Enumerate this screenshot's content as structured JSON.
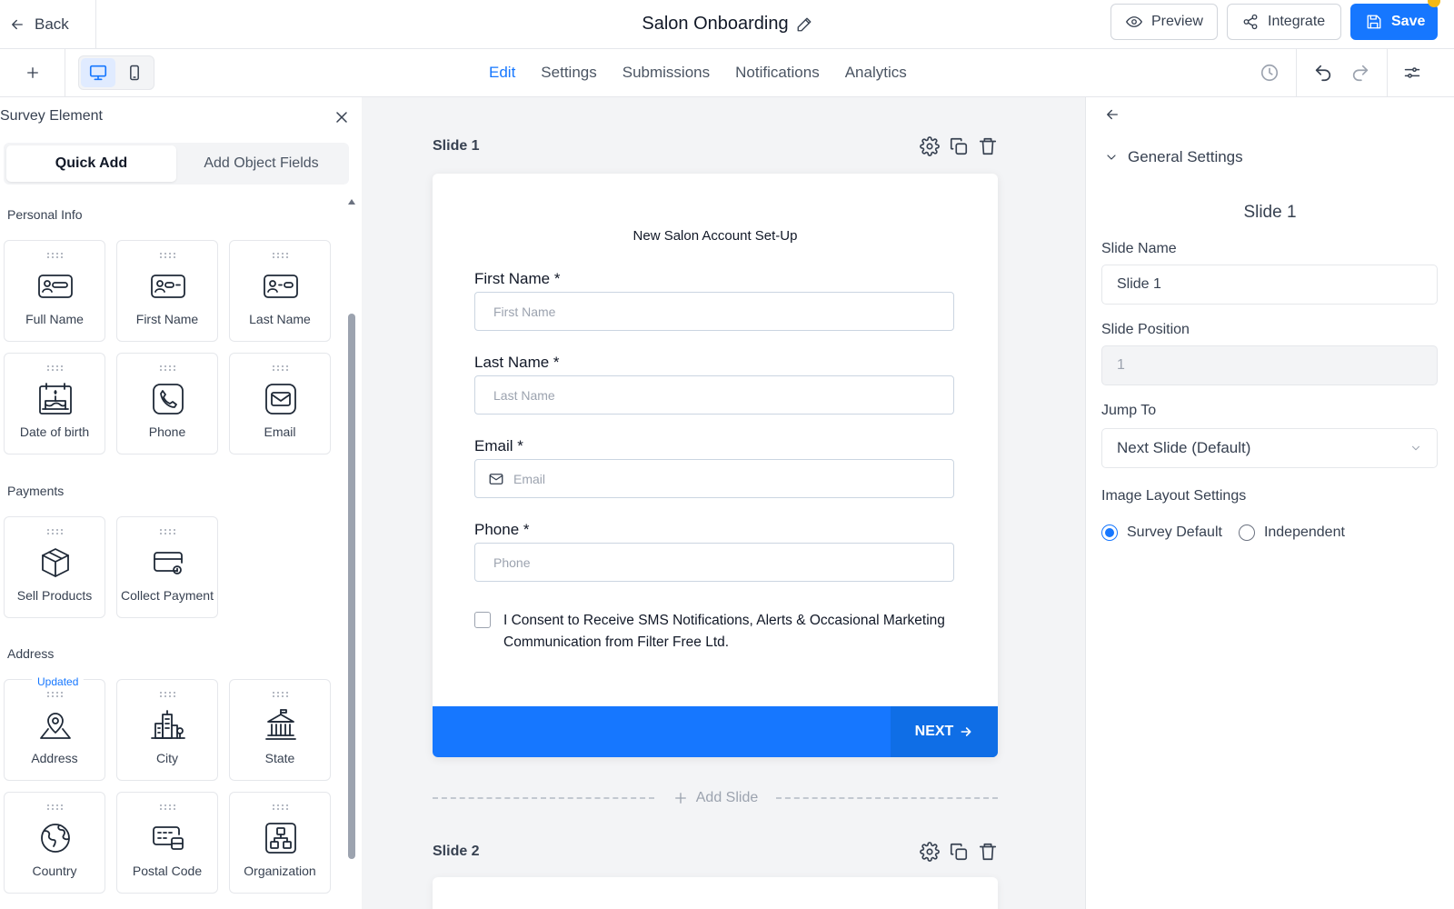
{
  "header": {
    "back_label": "Back",
    "title": "Salon Onboarding",
    "preview_label": "Preview",
    "integrate_label": "Integrate",
    "save_label": "Save"
  },
  "toolbar": {
    "tabs": [
      {
        "label": "Edit",
        "active": true
      },
      {
        "label": "Settings"
      },
      {
        "label": "Submissions"
      },
      {
        "label": "Notifications"
      },
      {
        "label": "Analytics"
      }
    ]
  },
  "left_panel": {
    "title": "Survey Element",
    "segments": [
      "Quick Add",
      "Add Object Fields"
    ],
    "sections": {
      "personal_info": {
        "label": "Personal Info",
        "items": [
          {
            "label": "Full Name",
            "icon": "id-card-icon"
          },
          {
            "label": "First Name",
            "icon": "id-card-icon"
          },
          {
            "label": "Last Name",
            "icon": "id-card-icon"
          },
          {
            "label": "Date of birth",
            "icon": "birthday-cake-icon"
          },
          {
            "label": "Phone",
            "icon": "phone-icon"
          },
          {
            "label": "Email",
            "icon": "mail-icon"
          }
        ]
      },
      "payments": {
        "label": "Payments",
        "items": [
          {
            "label": "Sell Products",
            "icon": "box-icon"
          },
          {
            "label": "Collect Payment",
            "icon": "credit-card-icon"
          }
        ]
      },
      "address": {
        "label": "Address",
        "items": [
          {
            "label": "Address",
            "icon": "map-pin-icon",
            "badge": "Updated"
          },
          {
            "label": "City",
            "icon": "city-icon"
          },
          {
            "label": "State",
            "icon": "government-building-icon"
          },
          {
            "label": "Country",
            "icon": "globe-icon"
          },
          {
            "label": "Postal Code",
            "icon": "postal-icon"
          },
          {
            "label": "Organization",
            "icon": "org-chart-icon"
          }
        ]
      }
    }
  },
  "canvas": {
    "slide1": {
      "title": "Slide 1",
      "heading": "New Salon Account Set-Up",
      "fields": [
        {
          "label": "First Name *",
          "placeholder": "First Name"
        },
        {
          "label": "Last Name *",
          "placeholder": "Last Name"
        },
        {
          "label": "Email *",
          "placeholder": "Email"
        },
        {
          "label": "Phone *",
          "placeholder": "Phone"
        }
      ],
      "consent": "I Consent to Receive SMS Notifications, Alerts & Occasional Marketing Communication from Filter Free Ltd.",
      "next_label": "NEXT"
    },
    "add_slide_label": "Add Slide",
    "slide2": {
      "title": "Slide 2"
    }
  },
  "right_panel": {
    "section_title": "General Settings",
    "slide_name_display": "Slide 1",
    "slide_name_label": "Slide Name",
    "slide_name_value": "Slide 1",
    "slide_position_label": "Slide Position",
    "slide_position_value": "1",
    "jump_to_label": "Jump To",
    "jump_to_value": "Next Slide (Default)",
    "image_layout_label": "Image Layout Settings",
    "options": [
      {
        "label": "Survey Default",
        "selected": true
      },
      {
        "label": "Independent",
        "selected": false
      }
    ]
  },
  "colors": {
    "accent": "#1677ff",
    "badge": "#f5b914"
  }
}
